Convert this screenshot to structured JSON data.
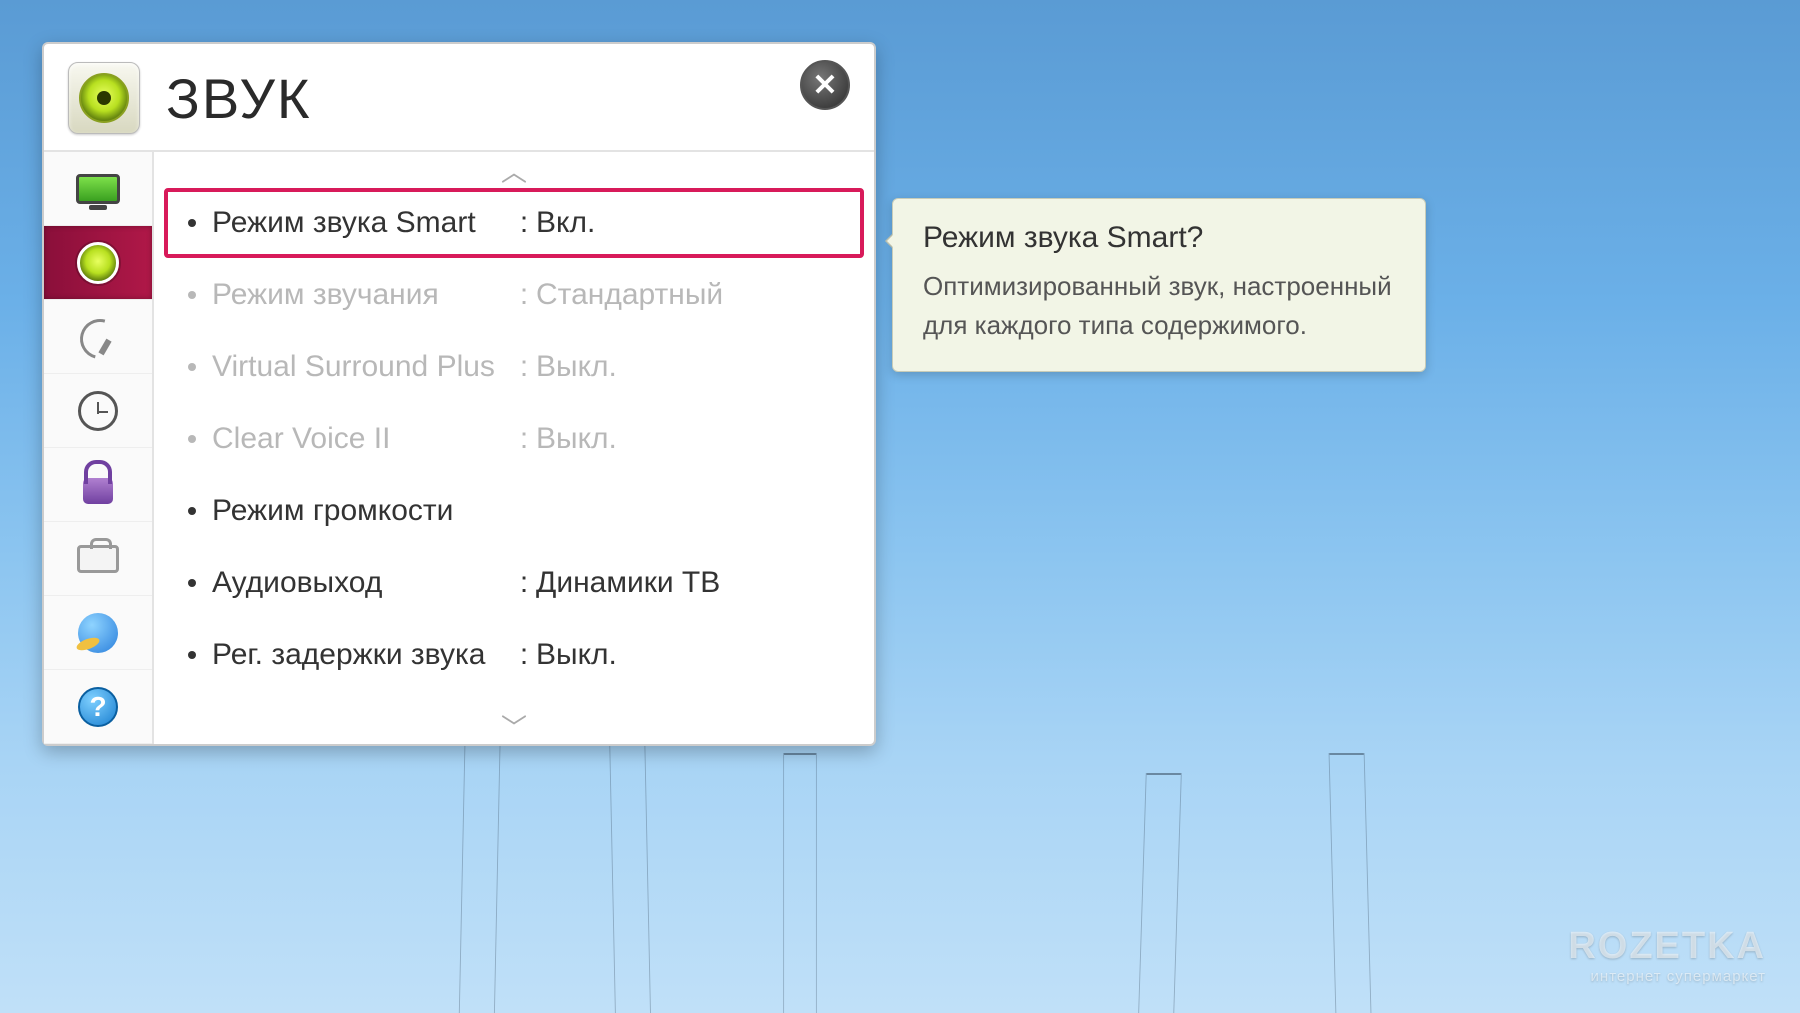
{
  "header": {
    "title": "ЗВУК"
  },
  "sidebar": {
    "items": [
      {
        "name": "picture",
        "icon": "monitor-icon"
      },
      {
        "name": "sound",
        "icon": "speaker-icon",
        "selected": true
      },
      {
        "name": "channel",
        "icon": "satellite-icon"
      },
      {
        "name": "time",
        "icon": "clock-icon"
      },
      {
        "name": "lock",
        "icon": "lock-icon"
      },
      {
        "name": "option",
        "icon": "toolbox-icon"
      },
      {
        "name": "network",
        "icon": "globe-icon"
      },
      {
        "name": "support",
        "icon": "help-icon"
      }
    ]
  },
  "options": [
    {
      "label": "Режим звука Smart",
      "value": "Вкл.",
      "state": "highlighted"
    },
    {
      "label": "Режим звучания",
      "value": "Стандартный",
      "state": "disabled"
    },
    {
      "label": "Virtual Surround Plus",
      "value": "Выкл.",
      "state": "disabled"
    },
    {
      "label": "Clear Voice II",
      "value": "Выкл.",
      "state": "disabled"
    },
    {
      "label": "Режим громкости",
      "value": "",
      "state": "normal"
    },
    {
      "label": "Аудиовыход",
      "value": "Динамики ТВ",
      "state": "normal"
    },
    {
      "label": "Рег. задержки звука",
      "value": "Выкл.",
      "state": "normal"
    }
  ],
  "tooltip": {
    "title": "Режим звука Smart?",
    "body": "Оптимизированный звук, настроенный для каждого типа содержимого."
  },
  "watermark": {
    "brand": "ROZETKA",
    "tagline": "интернет супермаркет"
  },
  "colors": {
    "highlight": "#d81a5a",
    "sidebar_selected": "#9a1040"
  }
}
